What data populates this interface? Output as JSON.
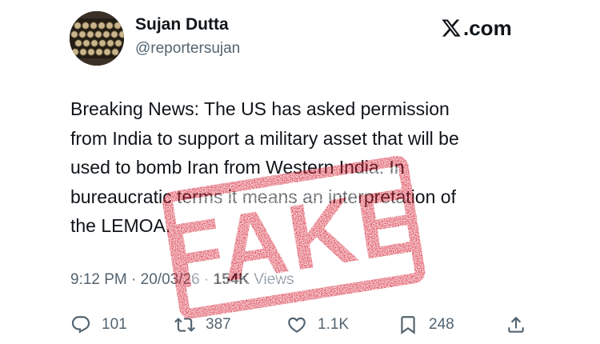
{
  "author": {
    "name": "Sujan Dutta",
    "handle": "@reportersujan"
  },
  "site": {
    "label": ".com",
    "icon": "x-logo-icon"
  },
  "tweet": {
    "lines": [
      "Breaking News: The US has asked permission",
      "from India to support a military asset that will be",
      "used to bomb Iran from Western India. In",
      "bureaucratic terms it means an interpretation of",
      "the LEMOA."
    ]
  },
  "meta": {
    "time": "9:12 PM",
    "separator": " · ",
    "date": "20/03/26",
    "views_count": "154K",
    "views_label": "Views"
  },
  "actions": {
    "reply": {
      "count": "101",
      "icon": "reply-icon"
    },
    "repost": {
      "count": "387",
      "icon": "repost-icon"
    },
    "like": {
      "count": "1.1K",
      "icon": "heart-icon"
    },
    "bookmark": {
      "count": "248",
      "icon": "bookmark-icon"
    },
    "share": {
      "icon": "share-icon"
    }
  },
  "stamp": {
    "text": "FAKE",
    "color": "#d7283a"
  },
  "colors": {
    "text": "#0f1419",
    "muted": "#536471",
    "background": "#ffffff"
  }
}
